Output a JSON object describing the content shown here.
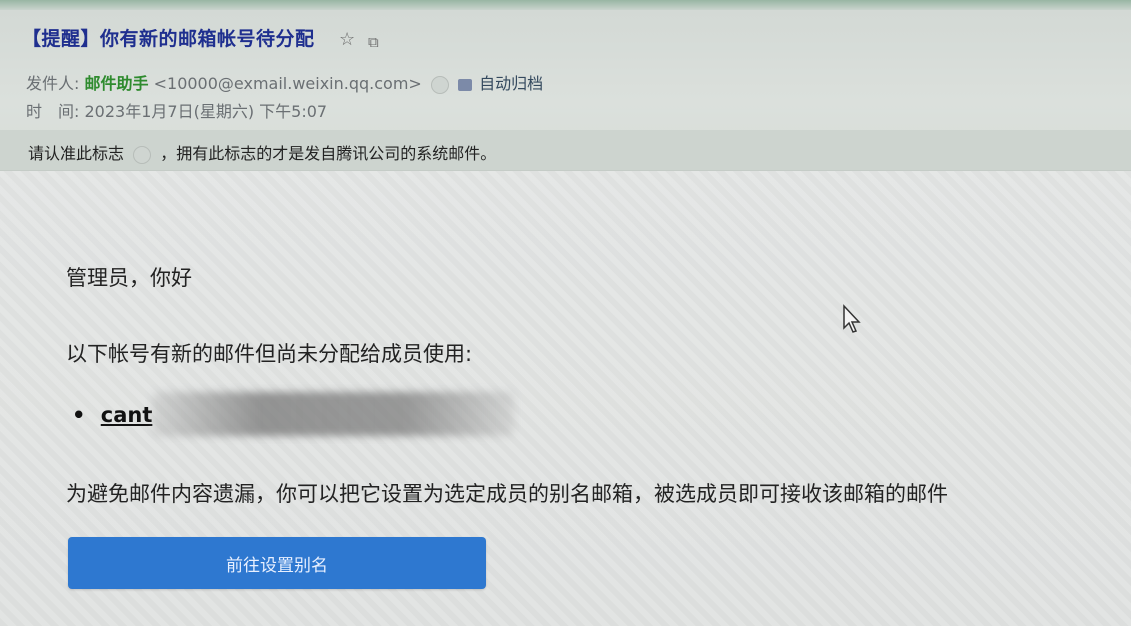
{
  "email": {
    "subject": "【提醒】你有新的邮箱帐号待分配",
    "sender_label": "发件人:",
    "sender_name": "邮件助手",
    "sender_address": "<10000@exmail.weixin.qq.com>",
    "archive_label": "自动归档",
    "time_label": "时　间:",
    "time_value": "2023年1月7日(星期六) 下午5:07",
    "notice_prefix": "请认准此标志",
    "notice_suffix": "，拥有此标志的才是发自腾讯公司的系统邮件。"
  },
  "body": {
    "greeting": "管理员，你好",
    "line1": "以下帐号有新的邮件但尚未分配给成员使用:",
    "bullet_dot": "•",
    "account": "cant",
    "line2": "为避免邮件内容遗漏，你可以把它设置为选定成员的别名邮箱，被选成员即可接收该邮箱的邮件",
    "button_label": "前往设置别名"
  },
  "icons": {
    "star": "star-icon",
    "window": "window-icon",
    "verified": "verified-icon",
    "archive": "archive-icon",
    "cursor": "mouse-cursor-icon"
  },
  "colors": {
    "subject": "#1f2f8f",
    "sender_name": "#2e8b2e",
    "button": "#2e78d0"
  }
}
